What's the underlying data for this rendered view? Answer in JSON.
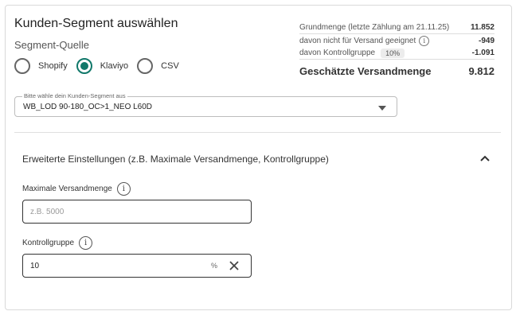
{
  "title": "Kunden-Segment auswählen",
  "source_label": "Segment-Quelle",
  "sources": [
    {
      "label": "Shopify",
      "checked": false
    },
    {
      "label": "Klaviyo",
      "checked": true
    },
    {
      "label": "CSV",
      "checked": false
    }
  ],
  "stats": {
    "base_label": "Grundmenge (letzte Zählung am 21.11.25)",
    "base_value": "11.852",
    "unsuitable_label": "davon nicht für Versand geeignet",
    "unsuitable_value": "-949",
    "control_label": "davon Kontrollgruppe",
    "control_pct": "10%",
    "control_value": "-1.091",
    "total_label": "Geschätzte Versandmenge",
    "total_value": "9.812"
  },
  "segment_select": {
    "legend": "Bitte wähle dein Kunden-Segment aus",
    "value": "WB_LOD 90-180_OC>1_NEO L60D"
  },
  "advanced": {
    "title": "Erweiterte Einstellungen (z.B. Maximale Versandmenge, Kontrollgruppe)",
    "max_label": "Maximale Versandmenge",
    "max_placeholder": "z.B. 5000",
    "max_value": "",
    "control_label": "Kontrollgruppe",
    "control_value": "10",
    "control_suffix": "%"
  },
  "colors": {
    "accent": "#11786a",
    "border": "#d9d9d9"
  },
  "icons": [
    "info-icon",
    "chevron-up-icon",
    "close-icon",
    "dropdown-caret-icon"
  ]
}
